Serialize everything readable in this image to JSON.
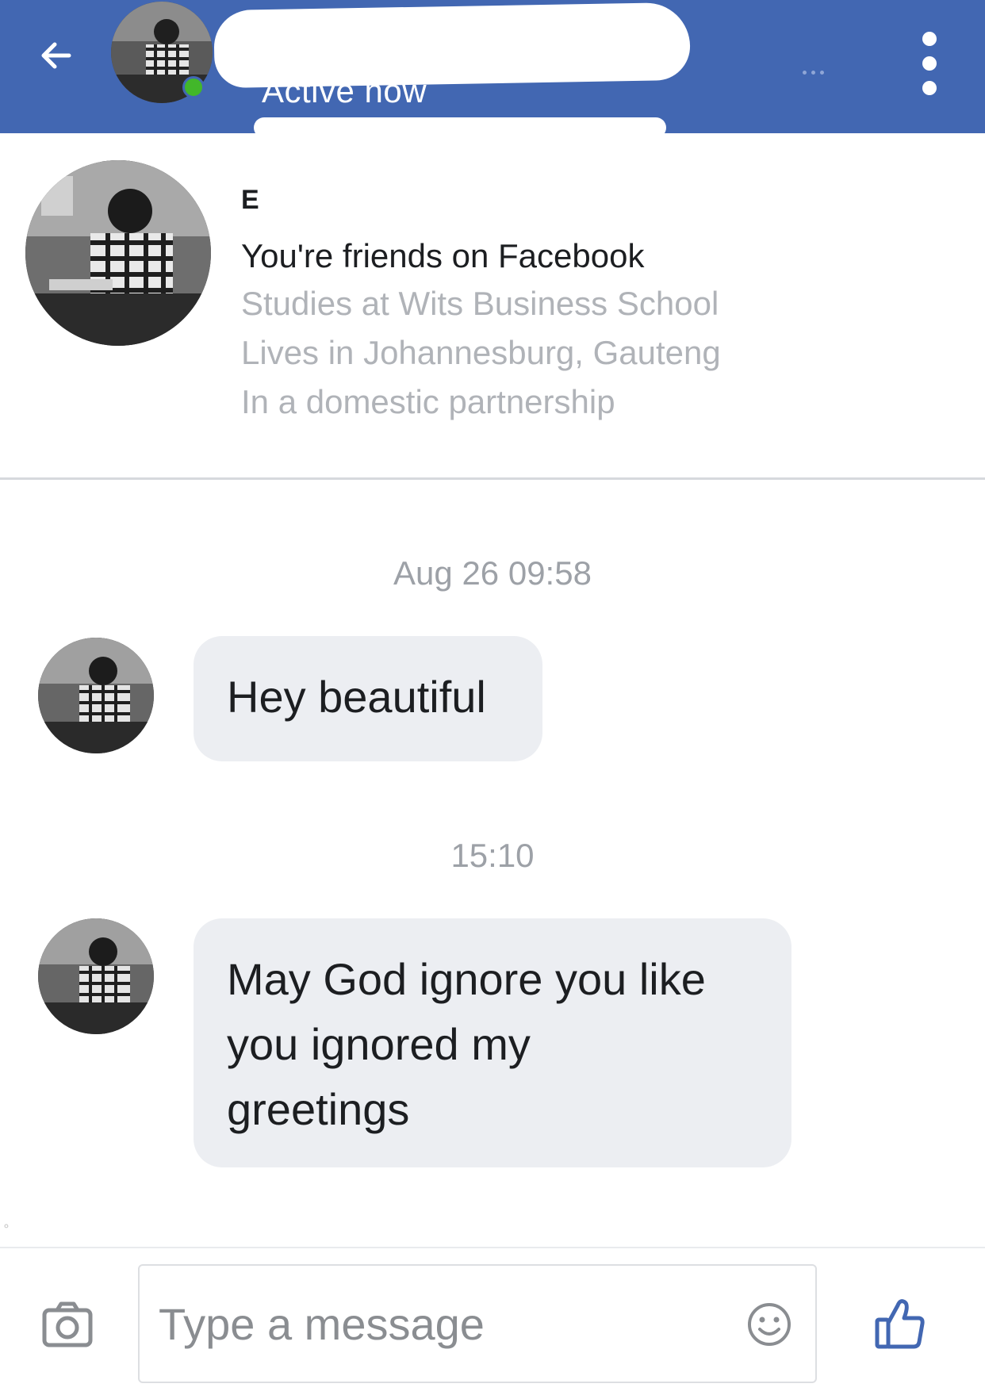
{
  "header": {
    "status": "Active now",
    "back_icon": "arrow-left-icon",
    "menu_icon": "more-vertical-icon",
    "accent_color": "#4267b2",
    "online_color": "#42b72a"
  },
  "profile": {
    "initial": "E",
    "friends_text": "You're friends on Facebook",
    "details": [
      "Studies at Wits Business School",
      "Lives in Johannesburg, Gauteng",
      "In a domestic partnership"
    ]
  },
  "thread": [
    {
      "timestamp": "Aug 26 09:58",
      "message": "Hey beautiful"
    },
    {
      "timestamp": "15:10",
      "message_lines": [
        "May God ignore you like",
        "you ignored my",
        "greetings"
      ]
    }
  ],
  "composer": {
    "placeholder": "Type a message",
    "camera_icon": "camera-icon",
    "emoji_icon": "emoji-icon",
    "like_icon": "thumbs-up-icon"
  }
}
